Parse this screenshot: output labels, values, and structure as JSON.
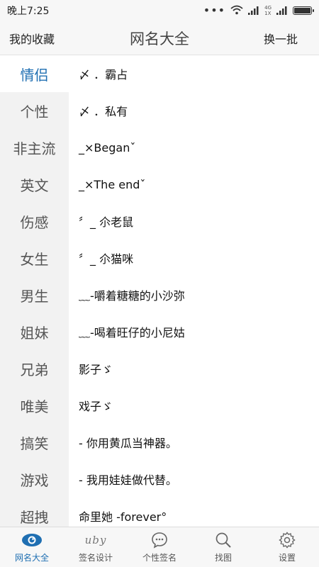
{
  "status_bar": {
    "time": "晚上7:25",
    "network_top": "4G",
    "network_bottom": "1X",
    "battery_level": 1.0
  },
  "header": {
    "left_label": "我的收藏",
    "title": "网名大全",
    "right_label": "换一批"
  },
  "sidebar": {
    "items": [
      {
        "label": "情侣"
      },
      {
        "label": "个性"
      },
      {
        "label": "非主流"
      },
      {
        "label": "英文"
      },
      {
        "label": "伤感"
      },
      {
        "label": "女生"
      },
      {
        "label": "男生"
      },
      {
        "label": "姐妹"
      },
      {
        "label": "兄弟"
      },
      {
        "label": "唯美"
      },
      {
        "label": "搞笑"
      },
      {
        "label": "游戏"
      },
      {
        "label": "超拽"
      }
    ]
  },
  "names": [
    "〆   ．霸占",
    "〆    ．私有",
    "_×Beganˇ",
    "_×The endˇ",
    "〞_ 尒老鼠",
    "〞_ 尒猫咪",
    "﹏-嚼着糖糖的小沙弥",
    "﹏-喝着旺仔的小尼姑",
    "影子ゞ",
    "戏子ゞ",
    "- 你用黄瓜当神器。",
    "- 我用娃娃做代替。",
    "命里她 -forever°"
  ],
  "bottom_nav": {
    "items": [
      {
        "label": "网名大全",
        "icon": "eye-icon"
      },
      {
        "label": "签名设计",
        "icon": "signature-icon",
        "icon_text": "uby"
      },
      {
        "label": "个性签名",
        "icon": "chat-bubble-icon"
      },
      {
        "label": "找图",
        "icon": "search-icon"
      },
      {
        "label": "设置",
        "icon": "gear-icon"
      }
    ]
  },
  "colors": {
    "accent": "#1f6fb2",
    "sidebar_bg": "#f2f2f2",
    "bar_bg": "#f7f7f7"
  }
}
